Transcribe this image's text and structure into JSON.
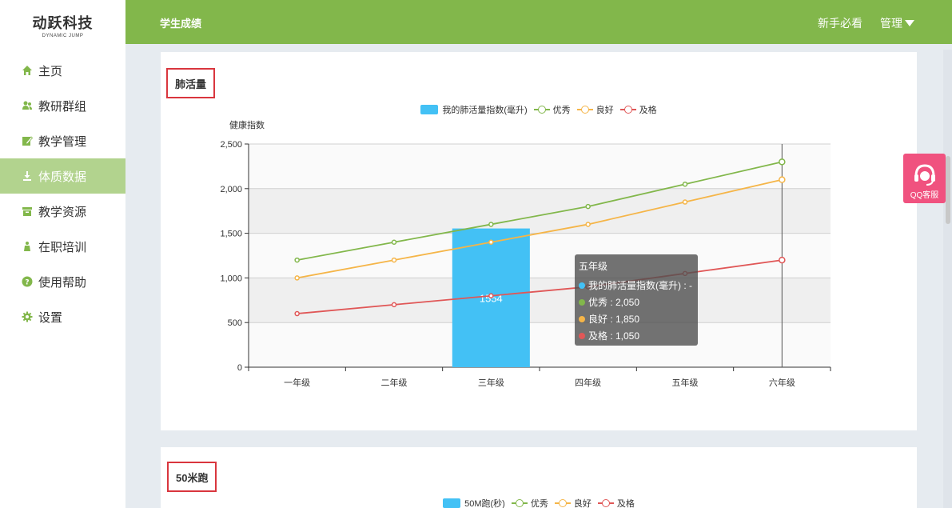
{
  "logo": {
    "name": "动跃科技",
    "sub": "DYNAMIC JUMP"
  },
  "nav": [
    {
      "label": "主页",
      "icon": "home-icon"
    },
    {
      "label": "教研群组",
      "icon": "group-icon"
    },
    {
      "label": "教学管理",
      "icon": "edit-icon"
    },
    {
      "label": "体质数据",
      "icon": "download-icon",
      "active": true
    },
    {
      "label": "教学资源",
      "icon": "box-icon"
    },
    {
      "label": "在职培训",
      "icon": "person-icon"
    },
    {
      "label": "使用帮助",
      "icon": "help-icon"
    },
    {
      "label": "设置",
      "icon": "gear-icon"
    }
  ],
  "header": {
    "title": "学生成绩",
    "guide": "新手必看",
    "admin": "管理"
  },
  "qq": {
    "label": "QQ客服"
  },
  "colors": {
    "accent": "#82b74b",
    "bar": "#43c1f5",
    "excellent": "#82b74b",
    "good": "#f5b548",
    "pass": "#e05757",
    "highlight": "#d9363e"
  },
  "panel1": {
    "title": "肺活量",
    "legend": [
      "我的肺活量指数(毫升)",
      "优秀",
      "良好",
      "及格"
    ],
    "ylabel": "健康指数",
    "tooltip": {
      "title": "五年级",
      "rows": [
        {
          "label": "我的肺活量指数(毫升) : -",
          "color": "#43c1f5"
        },
        {
          "label": "优秀 : 2,050",
          "color": "#82b74b"
        },
        {
          "label": "良好 : 1,850",
          "color": "#f5b548"
        },
        {
          "label": "及格 : 1,050",
          "color": "#e05757"
        }
      ]
    }
  },
  "panel2": {
    "title": "50米跑",
    "legend": [
      "50M跑(秒)",
      "优秀",
      "良好",
      "及格"
    ]
  },
  "chart_data": {
    "type": "bar",
    "categories": [
      "一年级",
      "二年级",
      "三年级",
      "四年级",
      "五年级",
      "六年级"
    ],
    "yticks": [
      "0",
      "500",
      "1,000",
      "1,500",
      "2,000",
      "2,500"
    ],
    "ylim": [
      0,
      2500
    ],
    "ylabel": "健康指数",
    "bar": {
      "name": "我的肺活量指数(毫升)",
      "values": [
        null,
        null,
        1554,
        null,
        null,
        null
      ],
      "label": "1554"
    },
    "series": [
      {
        "name": "优秀",
        "values": [
          1200,
          1400,
          1600,
          1800,
          2050,
          2300
        ]
      },
      {
        "name": "良好",
        "values": [
          1000,
          1200,
          1400,
          1600,
          1850,
          2100
        ]
      },
      {
        "name": "及格",
        "values": [
          600,
          700,
          800,
          900,
          1050,
          1200
        ]
      }
    ]
  }
}
